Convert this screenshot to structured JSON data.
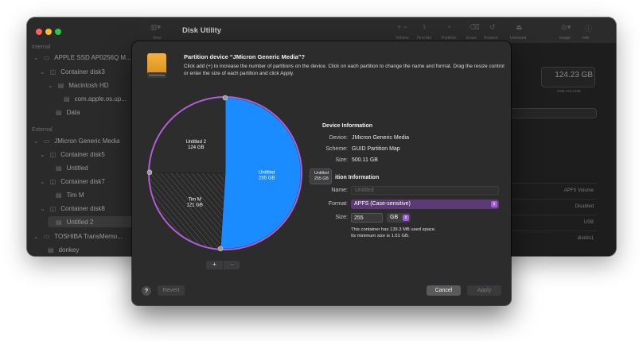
{
  "window": {
    "title": "Disk Utility",
    "view_label": "View",
    "toolbar": [
      "Volume",
      "First Aid",
      "Partition",
      "Erase",
      "Restore",
      "Unmount",
      "Image",
      "Info"
    ],
    "capacity": "124.23 GB",
    "capacity_label": "ONE VOLUME",
    "info_values": [
      "APFS Volume",
      "Disabled",
      "USB",
      "disk8s1"
    ]
  },
  "sidebar": {
    "internal_label": "Internal",
    "external_label": "External",
    "items": [
      "APPLE SSD AP0256Q M...",
      "Container disk3",
      "Macintosh HD",
      "com.apple.os.up...",
      "Data",
      "JMicron Generic Media",
      "Container disk5",
      "Untitled",
      "Container disk7",
      "Tim M",
      "Container disk8",
      "Untitled 2",
      "TOSHIBA TransMemo...",
      "donkey"
    ]
  },
  "sheet": {
    "title": "Partition device “JMicron Generic Media”?",
    "description": "Click add (+) to increase the number of partitions on the device. Click on each partition to change the name and format. Drag the resize control or enter the size of each partition and click Apply.",
    "device_info": {
      "header": "Device Information",
      "device_key": "Device:",
      "device_val": "JMicron Generic Media",
      "scheme_key": "Scheme:",
      "scheme_val": "GUID Partition Map",
      "size_key": "Size:",
      "size_val": "500.11 GB"
    },
    "partition_info": {
      "header": "ition Information",
      "name_key": "Name:",
      "name_placeholder": "Untitled",
      "format_key": "Format:",
      "format_val": "APFS (Case-sensitive)",
      "size_key": "Size:",
      "size_val": "255",
      "unit": "GB",
      "note_line1": "This container has 139.3 MB used space.",
      "note_line2": "Its minimum size is 1.51 GB."
    },
    "tooltip": {
      "line1": "Untitled",
      "line2": "255 GB"
    },
    "buttons": {
      "add": "+",
      "remove": "−",
      "help": "?",
      "revert": "Revert",
      "cancel": "Cancel",
      "apply": "Apply"
    }
  },
  "chart_data": {
    "type": "pie",
    "slices": [
      {
        "name": "Untitled",
        "size": "255 GB",
        "value": 255,
        "color": "#1a8cff"
      },
      {
        "name": "Tim M",
        "size": "121 GB",
        "value": 121,
        "color": "#262626",
        "pattern": "hatched"
      },
      {
        "name": "Untitled 2",
        "size": "124 GB",
        "value": 124,
        "color": "#2d2d2d"
      }
    ]
  },
  "colors": {
    "accent": "#1a8cff",
    "selection_outline": "#b15fd6",
    "format_popup": "#5b3a75"
  }
}
